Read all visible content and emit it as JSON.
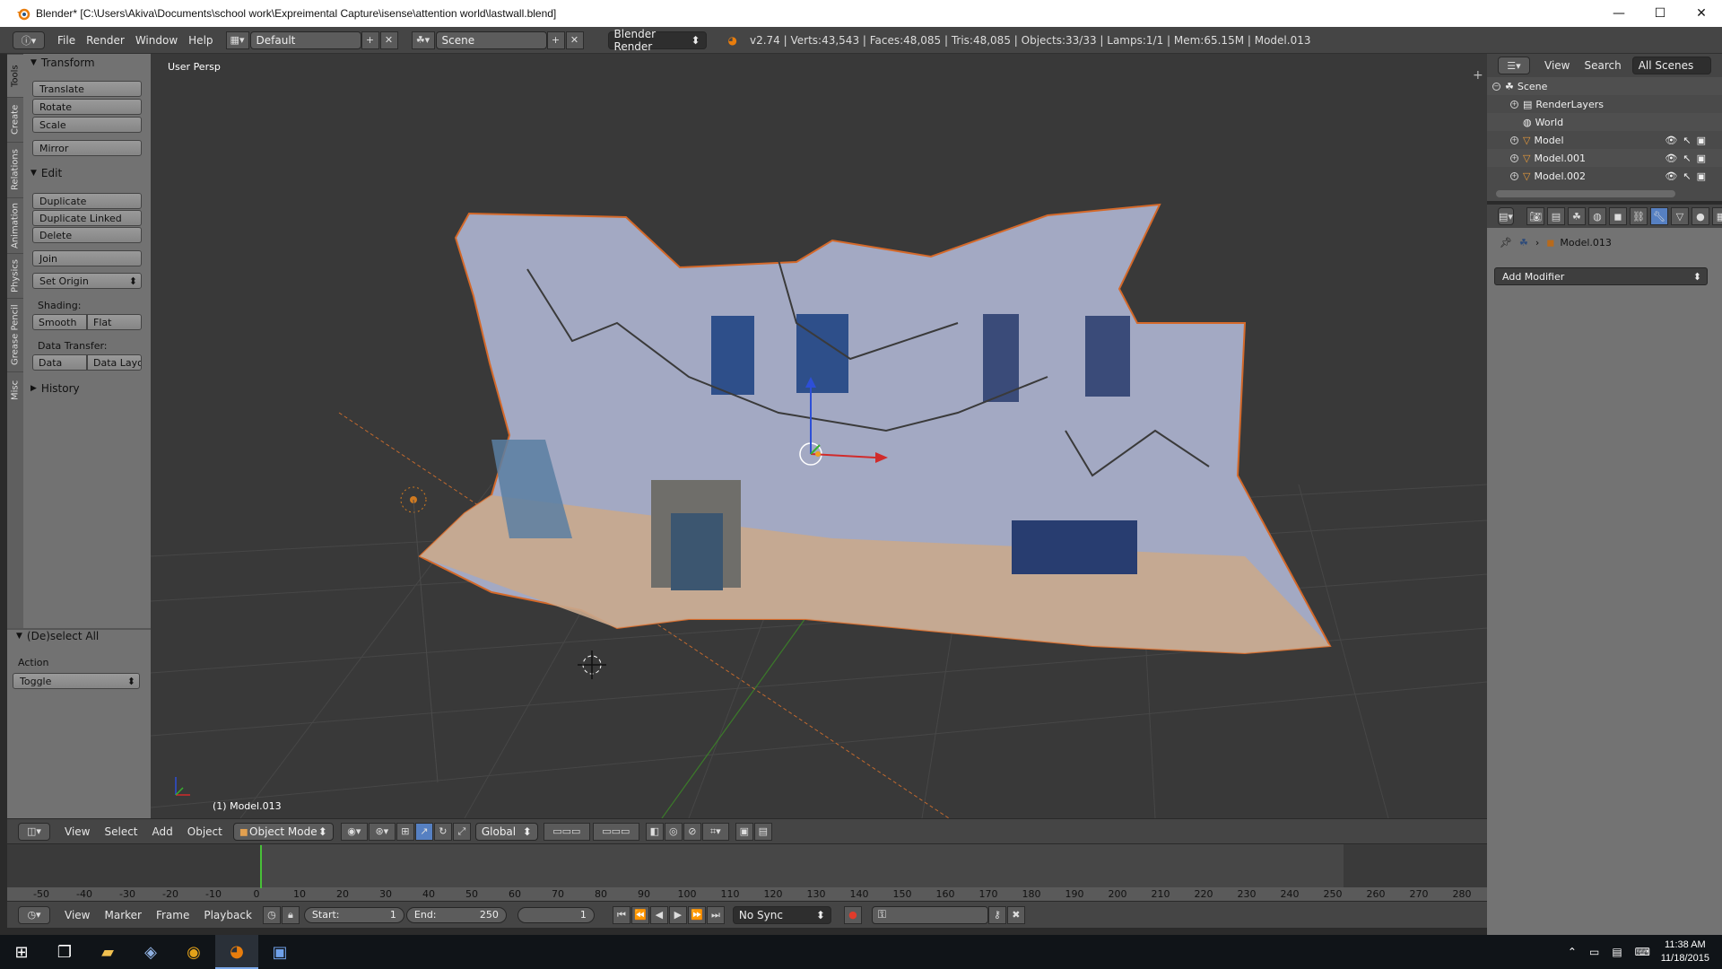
{
  "window": {
    "title": "Blender* [C:\\Users\\Akiva\\Documents\\school work\\Expreimental Capture\\isense\\attention world\\lastwall.blend]",
    "controls": [
      "—",
      "☐",
      "✕"
    ]
  },
  "main_header": {
    "menus": [
      "File",
      "Render",
      "Window",
      "Help"
    ],
    "layout": "Default",
    "scene": "Scene",
    "engine": "Blender Render",
    "stats": "v2.74 | Verts:43,543 | Faces:48,085 | Tris:48,085 | Objects:33/33 | Lamps:1/1 | Mem:65.15M | Model.013"
  },
  "tool_tabs": [
    "Tools",
    "Create",
    "Relations",
    "Animation",
    "Physics",
    "Grease Pencil",
    "Misc"
  ],
  "tool_shelf": {
    "transform_header": "Transform",
    "transform_buttons": [
      "Translate",
      "Rotate",
      "Scale",
      "Mirror"
    ],
    "edit_header": "Edit",
    "edit_buttons": [
      "Duplicate",
      "Duplicate Linked",
      "Delete",
      "Join"
    ],
    "set_origin": "Set Origin",
    "shading_label": "Shading:",
    "shading_smooth": "Smooth",
    "shading_flat": "Flat",
    "data_transfer_label": "Data Transfer:",
    "data_btn": "Data",
    "data_layout_btn": "Data Layo",
    "history_header": "History"
  },
  "operator_panel": {
    "header": "(De)select All",
    "action_label": "Action",
    "action_value": "Toggle"
  },
  "viewport": {
    "view_label": "User Persp",
    "active_object": "(1) Model.013"
  },
  "viewport_header": {
    "menus": [
      "View",
      "Select",
      "Add",
      "Object"
    ],
    "mode": "Object Mode",
    "orientation": "Global"
  },
  "timeline": {
    "ticks": [
      "-50",
      "-40",
      "-30",
      "-20",
      "-10",
      "0",
      "10",
      "20",
      "30",
      "40",
      "50",
      "60",
      "70",
      "80",
      "90",
      "100",
      "110",
      "120",
      "130",
      "140",
      "150",
      "160",
      "170",
      "180",
      "190",
      "200",
      "210",
      "220",
      "230",
      "240",
      "250",
      "260",
      "270",
      "280"
    ],
    "menus": [
      "View",
      "Marker",
      "Frame",
      "Playback"
    ],
    "start_label": "Start:",
    "start_value": "1",
    "end_label": "End:",
    "end_value": "250",
    "current_frame": "1",
    "sync": "No Sync"
  },
  "outliner": {
    "header_menus": [
      "View",
      "Search"
    ],
    "filter": "All Scenes",
    "rows": [
      "Scene",
      "RenderLayers",
      "World",
      "Model",
      "Model.001",
      "Model.002"
    ]
  },
  "properties": {
    "object_name": "Model.013",
    "add_modifier": "Add Modifier"
  },
  "taskbar": {
    "time": "11:38 AM",
    "date": "11/18/2015"
  }
}
